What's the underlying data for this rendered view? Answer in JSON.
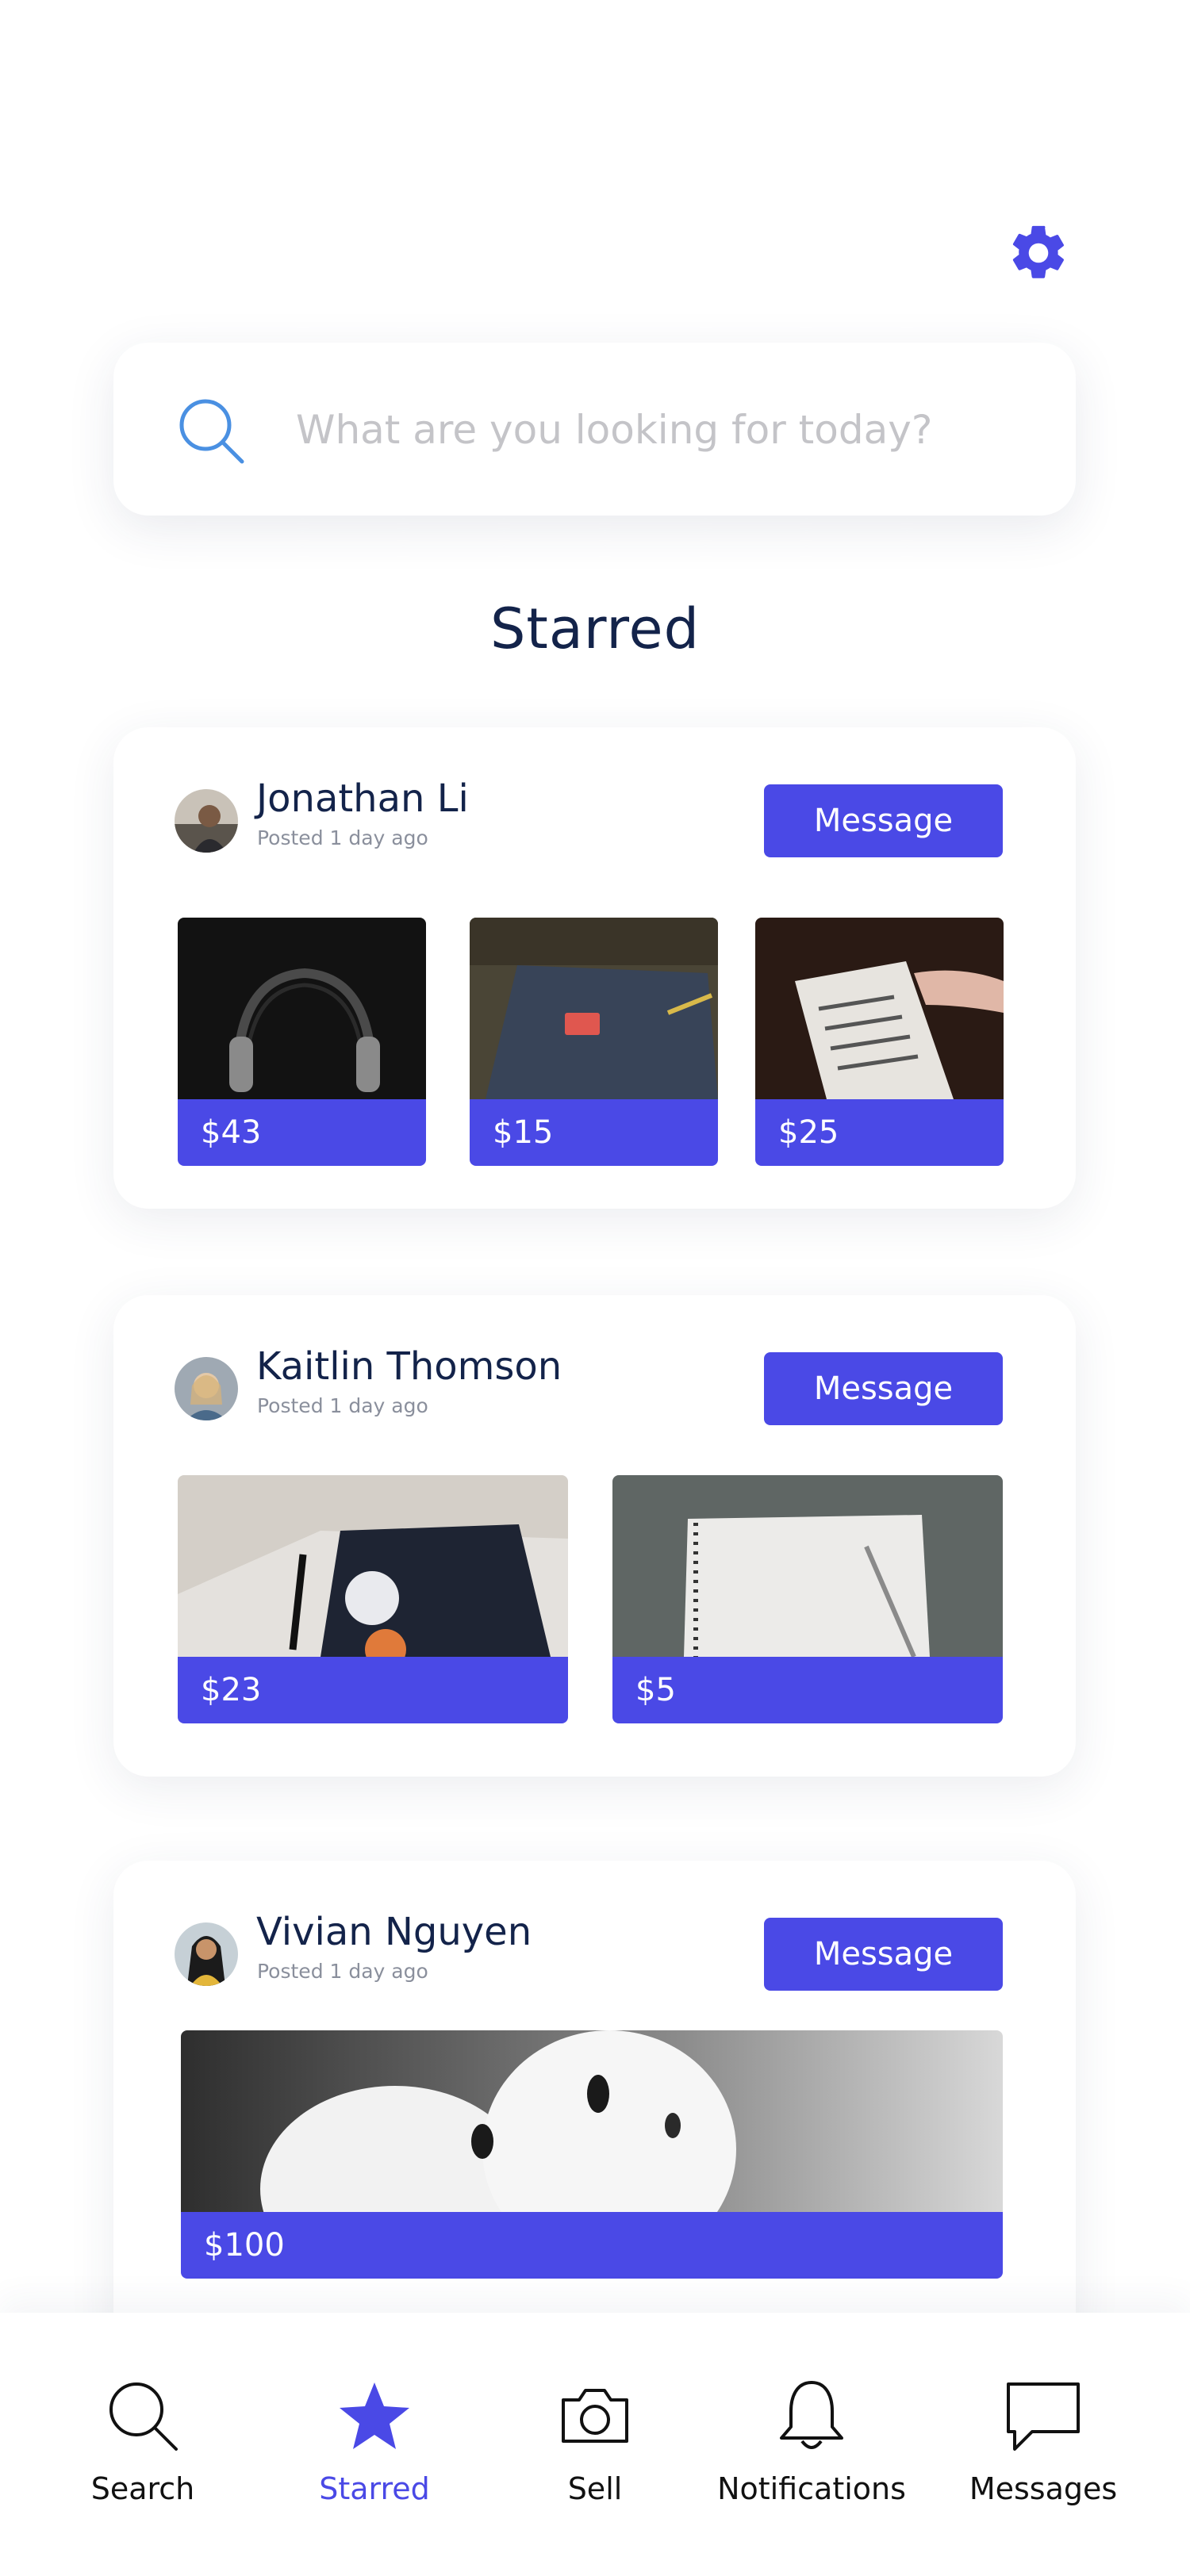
{
  "search": {
    "placeholder": "What are you looking for today?"
  },
  "section_title": "Starred",
  "message_label": "Message",
  "posts": [
    {
      "seller": "Jonathan Li",
      "posted": "Posted 1 day ago",
      "items": [
        {
          "price": "$43",
          "photo": "headphones"
        },
        {
          "price": "$15",
          "photo": "notebook"
        },
        {
          "price": "$25",
          "photo": "book"
        }
      ]
    },
    {
      "seller": "Kaitlin Thomson",
      "posted": "Posted 1 day ago",
      "items": [
        {
          "price": "$23",
          "photo": "journal-with-pen"
        },
        {
          "price": "$5",
          "photo": "spiral-notepad"
        }
      ]
    },
    {
      "seller": "Vivian Nguyen",
      "posted": "Posted 1 day ago",
      "items": [
        {
          "price": "$100",
          "photo": "earbuds"
        }
      ]
    }
  ],
  "nav": [
    {
      "label": "Search",
      "icon": "search-icon",
      "active": false
    },
    {
      "label": "Starred",
      "icon": "star-icon",
      "active": true
    },
    {
      "label": "Sell",
      "icon": "camera-icon",
      "active": false
    },
    {
      "label": "Notifications",
      "icon": "bell-icon",
      "active": false
    },
    {
      "label": "Messages",
      "icon": "chat-bubble-icon",
      "active": false
    }
  ],
  "colors": {
    "accent": "#4a49e6",
    "title": "#13234a",
    "search_icon": "#4a90e2"
  }
}
